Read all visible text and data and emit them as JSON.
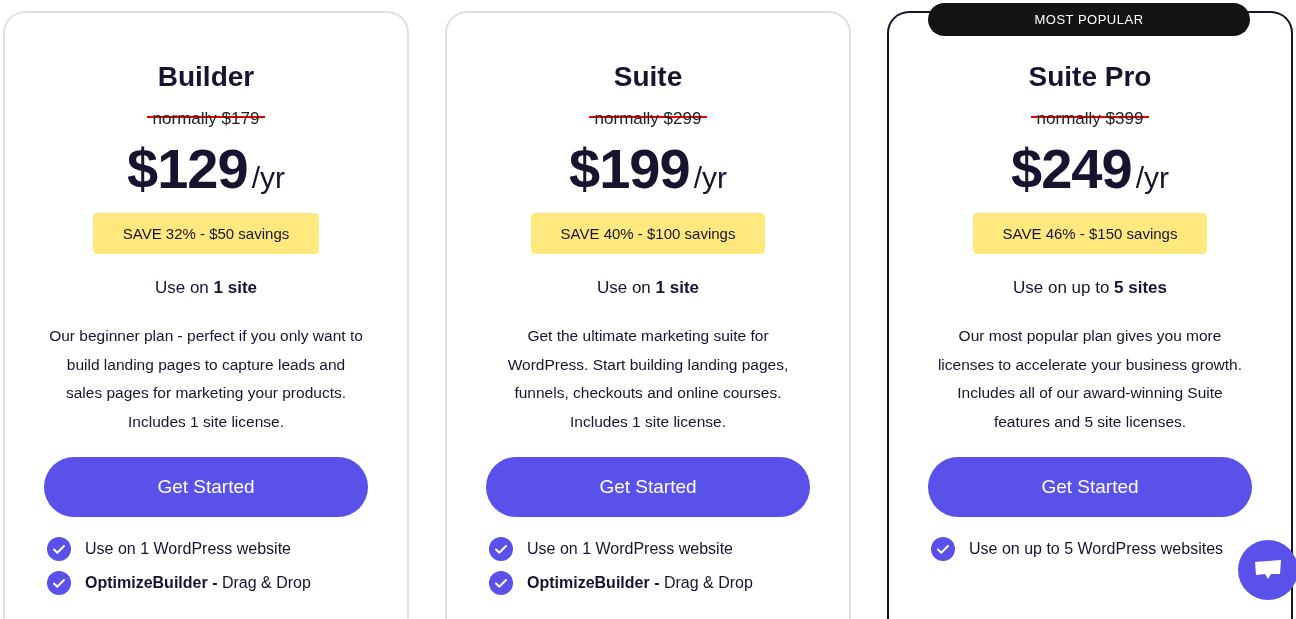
{
  "plans": [
    {
      "name": "Builder",
      "featured": false,
      "normal_price": "normally $179",
      "price": "$129",
      "period": "/yr",
      "savings": "SAVE 32% - $50 savings",
      "usage": "Use on **1 site**",
      "description": "Our beginner plan - perfect if you only want to build landing pages to capture leads and sales pages for marketing your products. Includes 1 site license.",
      "button": "Get Started",
      "features": [
        {
          "text": "Use on 1 WordPress website"
        },
        {
          "text": "**OptimizeBuilder -** Drag & Drop"
        }
      ]
    },
    {
      "name": "Suite",
      "featured": false,
      "normal_price": "normally $299",
      "price": "$199",
      "period": "/yr",
      "savings": "SAVE 40% - $100 savings",
      "usage": "Use on **1 site**",
      "description": "Get the ultimate marketing suite for WordPress. Start building landing pages, funnels, checkouts and online courses. Includes 1 site license.",
      "button": "Get Started",
      "features": [
        {
          "text": "Use on 1 WordPress website"
        },
        {
          "text": "**OptimizeBuilder -** Drag & Drop"
        }
      ]
    },
    {
      "name": "Suite Pro",
      "featured": true,
      "badge": "MOST POPULAR",
      "normal_price": "normally $399",
      "price": "$249",
      "period": "/yr",
      "savings": "SAVE 46% - $150 savings",
      "usage": "Use on up to **5 sites**",
      "description": "Our most popular plan gives you more licenses to accelerate your business growth. Includes all of our award-winning Suite features and 5 site licenses.",
      "button": "Get Started",
      "features": [
        {
          "text": "Use on up to 5 WordPress websites"
        }
      ]
    }
  ]
}
